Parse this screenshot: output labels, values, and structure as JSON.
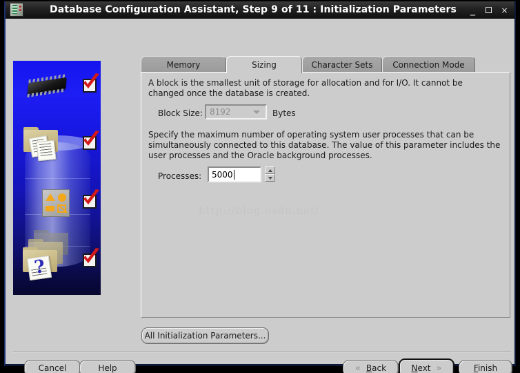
{
  "window": {
    "title": "Database Configuration Assistant, Step 9 of 11 : Initialization Parameters",
    "icon": "oracle-app-icon",
    "controls": {
      "minimize": "_",
      "maximize": "□",
      "close": "×"
    }
  },
  "tabs": [
    {
      "label": "Memory",
      "selected": false
    },
    {
      "label": "Sizing",
      "selected": true
    },
    {
      "label": "Character Sets",
      "selected": false
    },
    {
      "label": "Connection Mode",
      "selected": false
    }
  ],
  "panel": {
    "block_paragraph": "A block is the smallest unit of storage for allocation and for I/O. It cannot be changed once the database is created.",
    "block_size_label": "Block Size:",
    "block_size_value": "8192",
    "block_size_units": "Bytes",
    "processes_paragraph": "Specify the maximum number of operating system user processes that can be simultaneously connected to this database. The value of this parameter includes the user processes and the Oracle background processes.",
    "processes_label": "Processes:",
    "processes_value": "5000",
    "watermark": "http://blog.csdn.net/"
  },
  "actions": {
    "all_params": "All Initialization Parameters...",
    "cancel": "Cancel",
    "help": "Help",
    "back": "Back",
    "back_mnemonic": "B",
    "next": "Next",
    "next_mnemonic": "N",
    "finish": "Finish",
    "finish_mnemonic": "F",
    "back_chevron": "«",
    "next_chevron": "»"
  },
  "sidebar": {
    "alt": "Oracle database configuration steps banner",
    "steps_checked": 4
  },
  "colors": {
    "window_bg": "#cccccc",
    "titlebar": "#1a1a1a",
    "banner_blue": "#1414ef",
    "banner_blue_dark": "#070730",
    "check_red": "#d21a1a",
    "tab_inactive": "#9b9b9b"
  }
}
